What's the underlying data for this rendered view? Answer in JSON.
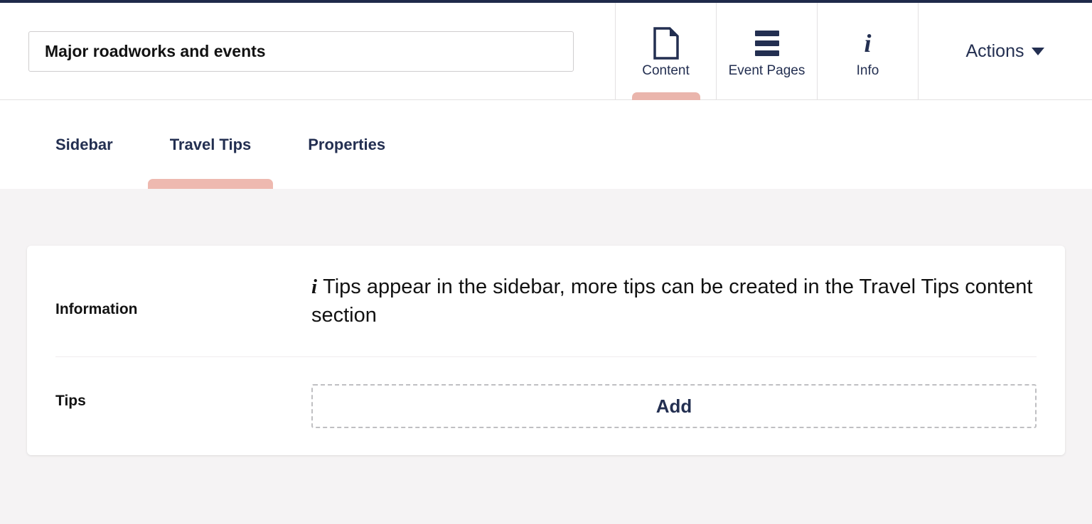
{
  "theme": {
    "accent_pink": "#eab5ac",
    "navy": "#232f51",
    "page_background": "#f5f3f4",
    "card_background": "#ffffff"
  },
  "header": {
    "title_input": {
      "value": "Major roadworks and events",
      "placeholder": "Title"
    },
    "tabs": [
      {
        "label": "Content",
        "icon": "document-icon",
        "active": true
      },
      {
        "label": "Event Pages",
        "icon": "list-icon",
        "active": false
      },
      {
        "label": "Info",
        "icon": "info-icon",
        "active": false
      }
    ],
    "actions": {
      "label": "Actions",
      "icon": "chevron-down-icon"
    }
  },
  "subnav": {
    "tabs": [
      {
        "label": "Sidebar",
        "active": false
      },
      {
        "label": "Travel Tips",
        "active": true
      },
      {
        "label": "Properties",
        "active": false
      }
    ]
  },
  "main": {
    "rows": [
      {
        "label": "Information",
        "icon": "info-icon",
        "text": "Tips appear in the sidebar, more tips can be created in the Travel Tips content section"
      },
      {
        "label": "Tips",
        "add_label": "Add"
      }
    ]
  }
}
